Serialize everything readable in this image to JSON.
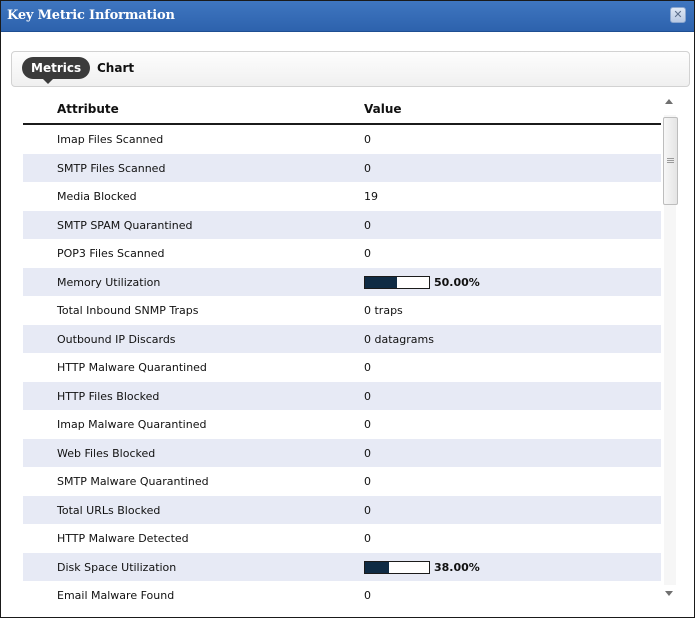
{
  "window": {
    "title": "Key Metric Information",
    "close_glyph": "✕"
  },
  "tabs": {
    "metrics_label": "Metrics",
    "chart_label": "Chart"
  },
  "table": {
    "columns": {
      "attribute": "Attribute",
      "value": "Value"
    },
    "rows": [
      {
        "attribute": "Imap Files Scanned",
        "value": "0"
      },
      {
        "attribute": "SMTP Files Scanned",
        "value": "0"
      },
      {
        "attribute": "Media Blocked",
        "value": "19"
      },
      {
        "attribute": "SMTP SPAM Quarantined",
        "value": "0"
      },
      {
        "attribute": "POP3 Files Scanned",
        "value": "0"
      },
      {
        "attribute": "Memory Utilization",
        "value": "50.00%",
        "percent": 50
      },
      {
        "attribute": "Total Inbound SNMP Traps",
        "value": "0 traps"
      },
      {
        "attribute": "Outbound IP Discards",
        "value": "0 datagrams"
      },
      {
        "attribute": "HTTP Malware Quarantined",
        "value": "0"
      },
      {
        "attribute": "HTTP Files Blocked",
        "value": "0"
      },
      {
        "attribute": "Imap Malware Quarantined",
        "value": "0"
      },
      {
        "attribute": "Web Files Blocked",
        "value": "0"
      },
      {
        "attribute": "SMTP Malware Quarantined",
        "value": "0"
      },
      {
        "attribute": "Total URLs Blocked",
        "value": "0"
      },
      {
        "attribute": "HTTP Malware Detected",
        "value": "0"
      },
      {
        "attribute": "Disk Space Utilization",
        "value": "38.00%",
        "percent": 38
      },
      {
        "attribute": "Email Malware Found",
        "value": "0"
      }
    ]
  },
  "colors": {
    "titlebar": "#3f76c0",
    "row_alt": "#e7eaf5",
    "bar_fill": "#0f2b44"
  }
}
